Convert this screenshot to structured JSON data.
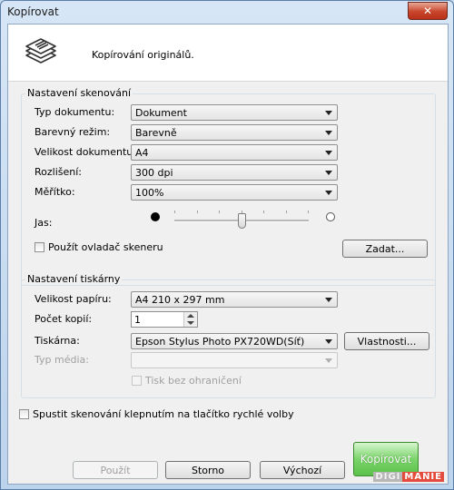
{
  "window": {
    "title": "Kopírovat",
    "close_label": "✕"
  },
  "header": {
    "text": "Kopírování originálů."
  },
  "scan_settings": {
    "legend": "Nastavení skenování",
    "document_type": {
      "label": "Typ dokumentu:",
      "value": "Dokument"
    },
    "color_mode": {
      "label": "Barevný režim:",
      "value": "Barevně"
    },
    "document_size": {
      "label": "Velikost dokumentu:",
      "value": "A4"
    },
    "resolution": {
      "label": "Rozlišení:",
      "value": "300 dpi"
    },
    "scale": {
      "label": "Měřítko:",
      "value": "100%"
    },
    "brightness": {
      "label": "Jas:",
      "level_fraction": 0.5
    },
    "use_scanner_driver": {
      "label": "Použít ovladač skeneru",
      "checked": false
    },
    "set_button": "Zadat..."
  },
  "printer_settings": {
    "legend": "Nastavení tiskárny",
    "paper_size": {
      "label": "Velikost papíru:",
      "value": "A4 210 x 297 mm"
    },
    "copies": {
      "label": "Počet kopií:",
      "value": "1"
    },
    "printer": {
      "label": "Tiskárna:",
      "value": "Epson Stylus Photo PX720WD(Síť)"
    },
    "properties_button": "Vlastnosti...",
    "media_type": {
      "label": "Typ média:",
      "value": ""
    },
    "borderless": {
      "label": "Tisk bez ohraničení",
      "checked": false
    }
  },
  "quick_start": {
    "label": "Spustit skenování klepnutím na tlačítko rychlé volby",
    "checked": false
  },
  "buttons": {
    "apply": "Použít",
    "cancel": "Storno",
    "default": "Výchozí",
    "copy": "Kopírovat"
  },
  "watermark": {
    "part1": "DIGI",
    "part2": "MANIE"
  },
  "colors": {
    "accent_green": "#5cc04b",
    "close_red": "#c8452c"
  }
}
